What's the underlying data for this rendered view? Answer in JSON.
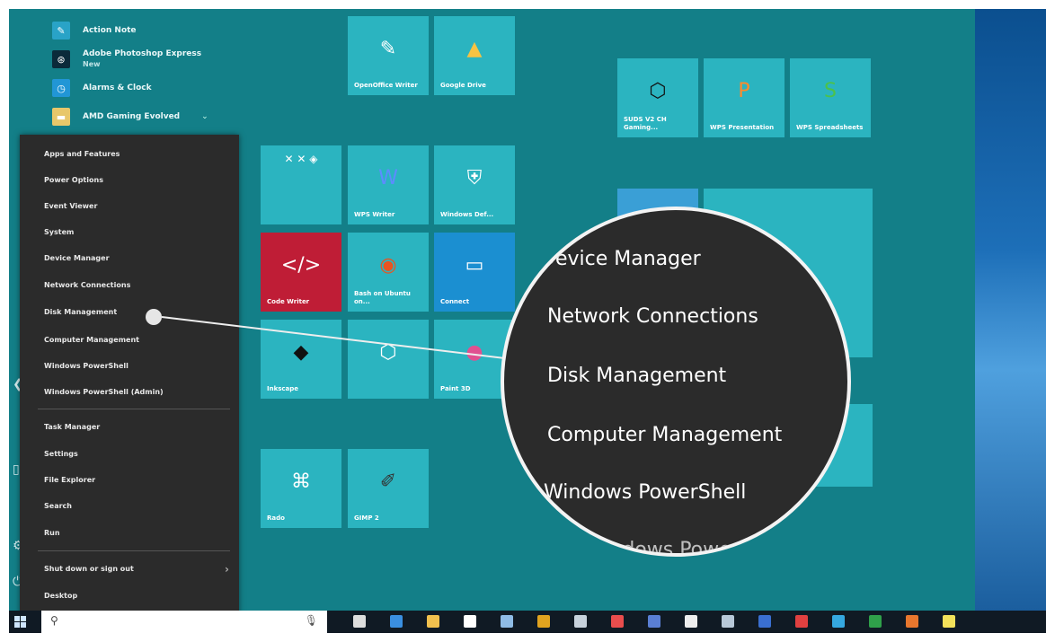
{
  "app_list": [
    {
      "label": "Action Note",
      "sub": "",
      "color": "#29a3c7",
      "icon": "note-icon"
    },
    {
      "label": "Adobe Photoshop Express",
      "sub": "New",
      "color": "#0b2a3a",
      "icon": "photoshop-icon"
    },
    {
      "label": "Alarms & Clock",
      "sub": "",
      "color": "#2196d6",
      "icon": "alarm-icon"
    },
    {
      "label": "AMD Gaming Evolved",
      "sub": "",
      "color": "#e8c76a",
      "icon": "folder-icon"
    }
  ],
  "tiles": [
    {
      "label": "OpenOffice Writer",
      "glyph": "✎",
      "color": "#2bb4c0"
    },
    {
      "label": "Google Drive",
      "glyph": "▲",
      "color": "#2bb4c0"
    },
    {
      "label": "SUDS V2 CH Gaming...",
      "glyph": "⬡",
      "color": "#2bb4c0"
    },
    {
      "label": "WPS Presentation",
      "glyph": "P",
      "color": "#2bb4c0"
    },
    {
      "label": "WPS Spreadsheets",
      "glyph": "S",
      "color": "#2bb4c0"
    },
    {
      "label": "",
      "glyph": "",
      "color": "#2bb4c0"
    },
    {
      "label": "WPS Writer",
      "glyph": "W",
      "color": "#2bb4c0"
    },
    {
      "label": "Windows Def...",
      "glyph": "⛨",
      "color": "#2bb4c0"
    },
    {
      "label": "Code Writer",
      "glyph": "</>",
      "color": "#bf1d36"
    },
    {
      "label": "Bash on Ubuntu on...",
      "glyph": "◉",
      "color": "#2bb4c0"
    },
    {
      "label": "Connect",
      "glyph": "▭",
      "color": "#1b8fd1"
    },
    {
      "label": "Inkscape",
      "glyph": "◆",
      "color": "#2bb4c0"
    },
    {
      "label": "",
      "glyph": "⬡",
      "color": "#2bb4c0"
    },
    {
      "label": "Paint 3D",
      "glyph": "●",
      "color": "#2bb4c0"
    },
    {
      "label": "Rado",
      "glyph": "⌘",
      "color": "#2bb4c0"
    },
    {
      "label": "GIMP 2",
      "glyph": "✐",
      "color": "#2bb4c0"
    }
  ],
  "winx_menu": {
    "group1": [
      "Apps and Features",
      "Power Options",
      "Event Viewer",
      "System",
      "Device Manager",
      "Network Connections",
      "Disk Management",
      "Computer Management",
      "Windows PowerShell",
      "Windows PowerShell (Admin)"
    ],
    "group2": [
      "Task Manager",
      "Settings",
      "File Explorer",
      "Search",
      "Run"
    ],
    "group3": [
      "Shut down or sign out",
      "Desktop"
    ]
  },
  "magnified": [
    "Device Manager",
    "Network Connections",
    "Disk Management",
    "Computer Management",
    "Windows PowerShell",
    "Windows PowerShell"
  ],
  "taskbar": {
    "search_placeholder": "",
    "icons": [
      {
        "name": "task-view-icon",
        "color": "#dddddd"
      },
      {
        "name": "edge-icon",
        "color": "#3a8fe0"
      },
      {
        "name": "file-explorer-icon",
        "color": "#f2c14e"
      },
      {
        "name": "store-icon",
        "color": "#ffffff"
      },
      {
        "name": "media-icon",
        "color": "#8fbce6"
      },
      {
        "name": "chrome-icon",
        "color": "#e0a31f"
      },
      {
        "name": "calendar-icon",
        "color": "#c7d2dc"
      },
      {
        "name": "mail-icon",
        "color": "#e84d4d"
      },
      {
        "name": "calculator-icon",
        "color": "#5a7fd4"
      },
      {
        "name": "envelope-icon",
        "color": "#eeeeee"
      },
      {
        "name": "camera-icon",
        "color": "#b8c8d8"
      },
      {
        "name": "word-icon",
        "color": "#3a6fd0"
      },
      {
        "name": "paint-icon",
        "color": "#e04040"
      },
      {
        "name": "telegram-icon",
        "color": "#35a8e0"
      },
      {
        "name": "excel-icon",
        "color": "#2fa04a"
      },
      {
        "name": "powerpoint-icon",
        "color": "#e8772e"
      },
      {
        "name": "sticky-notes-icon",
        "color": "#f3e15a"
      }
    ]
  }
}
